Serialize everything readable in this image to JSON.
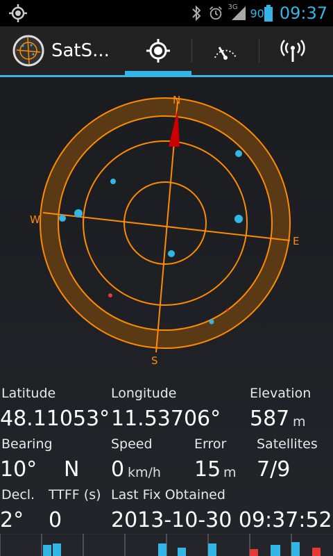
{
  "status_bar": {
    "left_icon": "gps-icon",
    "icons": [
      "bluetooth-icon",
      "alarm-icon",
      "signal-3g-icon"
    ],
    "network_label": "3G",
    "battery_level": "90",
    "time": "09:37"
  },
  "action_bar": {
    "app_title": "SatS...",
    "tabs": [
      {
        "icon": "locate-icon",
        "selected": true
      },
      {
        "icon": "speedometer-icon",
        "selected": false
      },
      {
        "icon": "antenna-icon",
        "selected": false
      }
    ]
  },
  "compass": {
    "labels": {
      "n": "N",
      "e": "E",
      "s": "S",
      "w": "W"
    },
    "bearing_deg": 10,
    "colors": {
      "ring": "#ff8c00",
      "needle": "#cc0000",
      "sat_used": "#33b5e5",
      "sat_unused": "#e53935"
    }
  },
  "stats": {
    "latitude": {
      "label": "Latitude",
      "value": "48.11053°"
    },
    "longitude": {
      "label": "Longitude",
      "value": "11.53706°"
    },
    "elevation": {
      "label": "Elevation",
      "value": "587",
      "unit": "m"
    },
    "bearing": {
      "label": "Bearing",
      "value": "10°",
      "direction": "N"
    },
    "speed": {
      "label": "Speed",
      "value": "0",
      "unit": "km/h"
    },
    "error": {
      "label": "Error",
      "value": "15",
      "unit": "m"
    },
    "satellites": {
      "label": "Satellites",
      "value": "7/9"
    },
    "declination": {
      "label": "Decl.",
      "value": "2°"
    },
    "ttff": {
      "label": "TTFF (s)",
      "value": "0"
    },
    "last_fix": {
      "label": "Last Fix Obtained",
      "value": "2013-10-30 09:37:52"
    }
  }
}
